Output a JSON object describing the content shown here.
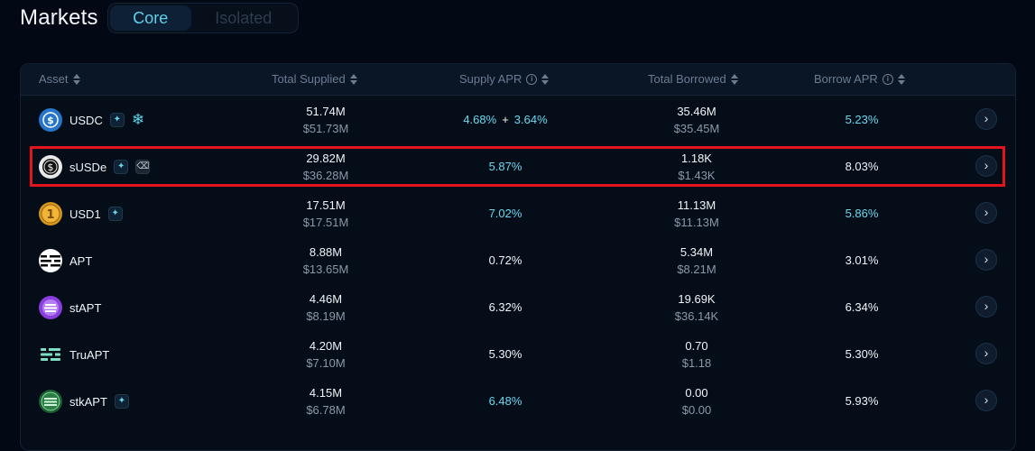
{
  "header": {
    "title": "Markets",
    "tabs": [
      {
        "label": "Core",
        "active": true
      },
      {
        "label": "Isolated",
        "active": false
      }
    ]
  },
  "table": {
    "columns": {
      "asset": "Asset",
      "total_supplied": "Total Supplied",
      "supply_apr": "Supply APR",
      "total_borrowed": "Total Borrowed",
      "borrow_apr": "Borrow APR"
    },
    "rows": [
      {
        "asset": "USDC",
        "supplied": "51.74M",
        "supplied_usd": "$51.73M",
        "supply_apr": "4.68%",
        "supply_apr_bonus": "3.64%",
        "supply_apr_color": "cyan",
        "borrowed": "35.46M",
        "borrowed_usd": "$35.45M",
        "borrow_apr": "5.23%",
        "borrow_apr_color": "cyan"
      },
      {
        "asset": "sUSDe",
        "supplied": "29.82M",
        "supplied_usd": "$36.28M",
        "supply_apr": "5.87%",
        "supply_apr_color": "cyan",
        "borrowed": "1.18K",
        "borrowed_usd": "$1.43K",
        "borrow_apr": "8.03%",
        "borrow_apr_color": "white"
      },
      {
        "asset": "USD1",
        "supplied": "17.51M",
        "supplied_usd": "$17.51M",
        "supply_apr": "7.02%",
        "supply_apr_color": "cyan",
        "borrowed": "11.13M",
        "borrowed_usd": "$11.13M",
        "borrow_apr": "5.86%",
        "borrow_apr_color": "cyan"
      },
      {
        "asset": "APT",
        "supplied": "8.88M",
        "supplied_usd": "$13.65M",
        "supply_apr": "0.72%",
        "supply_apr_color": "white",
        "borrowed": "5.34M",
        "borrowed_usd": "$8.21M",
        "borrow_apr": "3.01%",
        "borrow_apr_color": "white"
      },
      {
        "asset": "stAPT",
        "supplied": "4.46M",
        "supplied_usd": "$8.19M",
        "supply_apr": "6.32%",
        "supply_apr_color": "white",
        "borrowed": "19.69K",
        "borrowed_usd": "$36.14K",
        "borrow_apr": "6.34%",
        "borrow_apr_color": "white"
      },
      {
        "asset": "TruAPT",
        "supplied": "4.20M",
        "supplied_usd": "$7.10M",
        "supply_apr": "5.30%",
        "supply_apr_color": "white",
        "borrowed": "0.70",
        "borrowed_usd": "$1.18",
        "borrow_apr": "5.30%",
        "borrow_apr_color": "white"
      },
      {
        "asset": "stkAPT",
        "supplied": "4.15M",
        "supplied_usd": "$6.78M",
        "supply_apr": "6.48%",
        "supply_apr_color": "cyan",
        "borrowed": "0.00",
        "borrowed_usd": "$0.00",
        "borrow_apr": "5.93%",
        "borrow_apr_color": "white"
      }
    ],
    "row_action_glyph": "›",
    "plus_sign": "+",
    "info_glyph": "i"
  },
  "colors": {
    "accent": "#6ad9ef",
    "highlight": "#e3141c",
    "background": "#020914"
  },
  "icons": {
    "sort": "sort-icon",
    "info": "info-icon",
    "incentive": "sparkle-icon",
    "freeze": "snowflake-icon",
    "ethena": "ethena-icon",
    "row_action": "chevron-right-icon"
  }
}
